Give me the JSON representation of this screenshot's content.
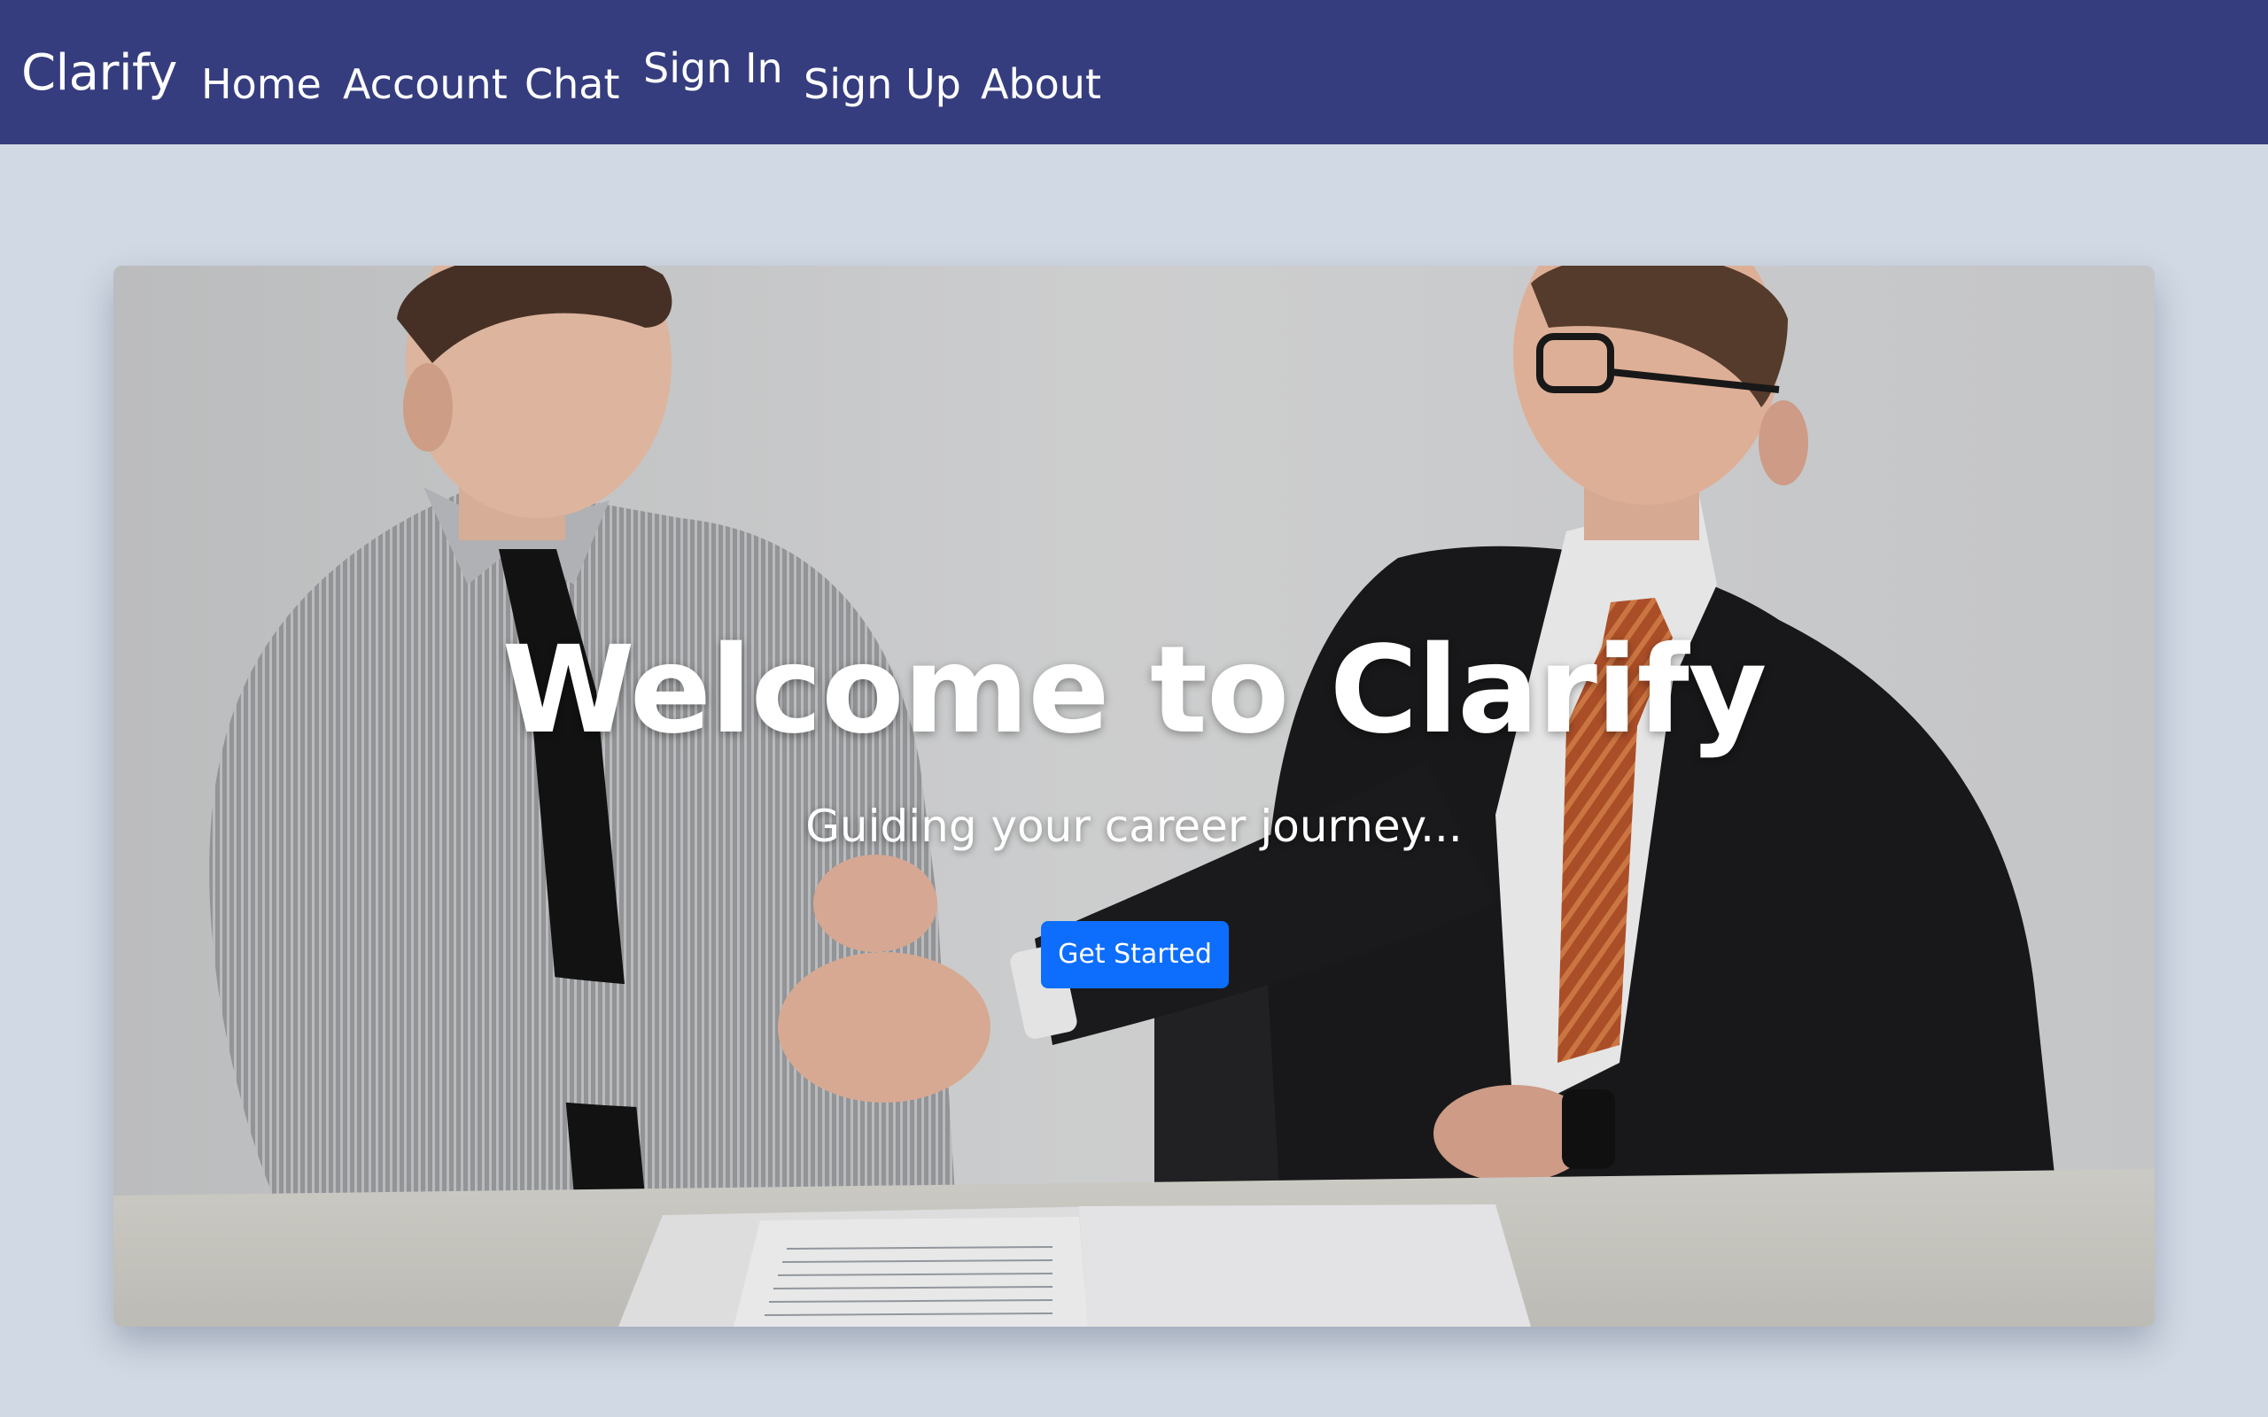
{
  "navbar": {
    "brand": "Clarify",
    "links": [
      {
        "label": "Home"
      },
      {
        "label": "Account"
      },
      {
        "label": "Chat"
      },
      {
        "label": "Sign In"
      },
      {
        "label": "Sign Up"
      },
      {
        "label": "About"
      }
    ],
    "background": "#353d7e"
  },
  "hero": {
    "title": "Welcome to Clarify",
    "subtitle": "Guiding your career journey...",
    "cta_label": "Get Started",
    "cta_color": "#0d6efd",
    "image": "photo of two men in business attire shaking hands across a table"
  },
  "page": {
    "background": "#d1d9e4"
  }
}
